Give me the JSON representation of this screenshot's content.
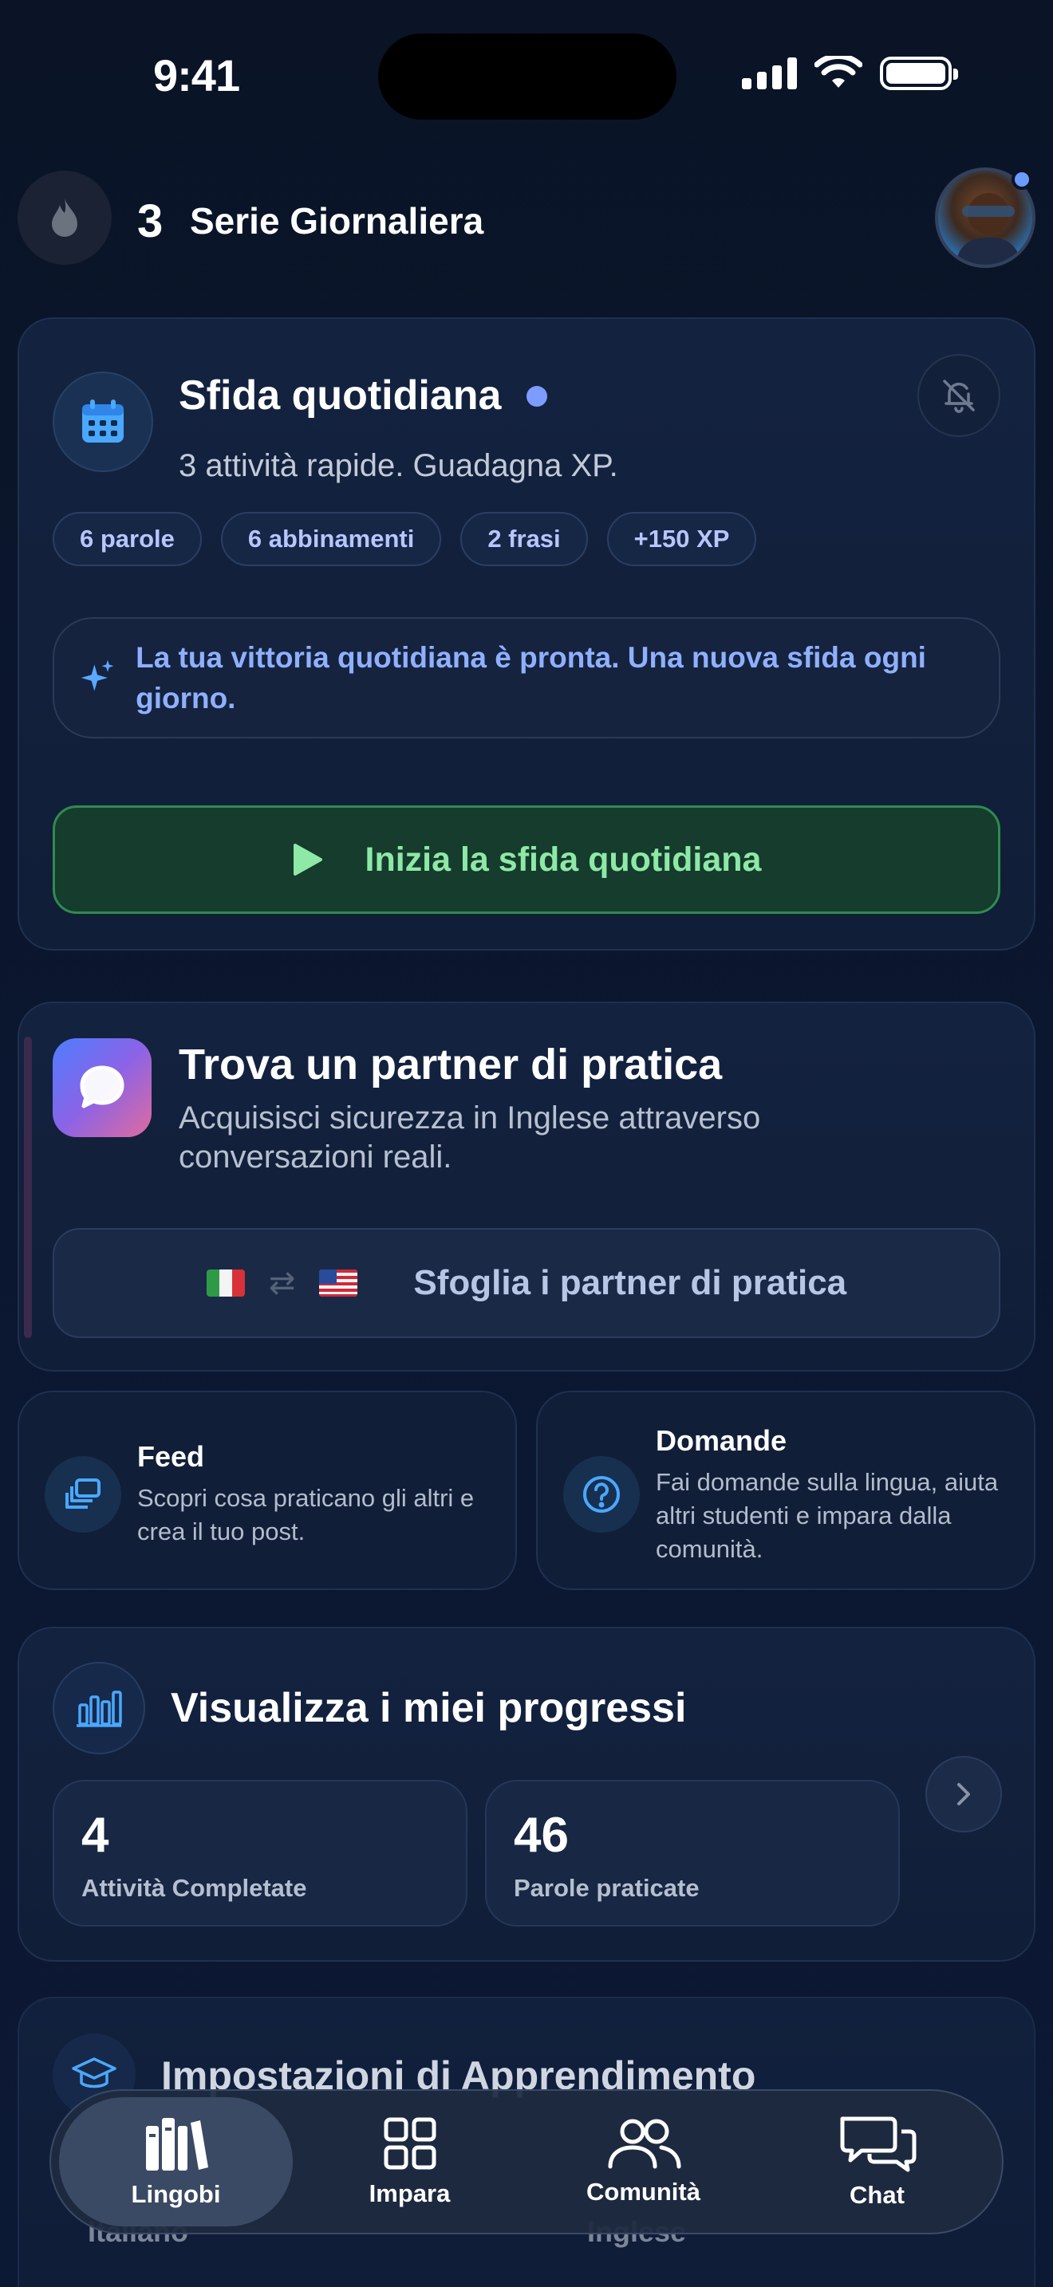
{
  "status_bar": {
    "time": "9:41"
  },
  "header": {
    "streak_count": "3",
    "streak_label": "Serie Giornaliera"
  },
  "challenge": {
    "title": "Sfida quotidiana",
    "subtitle": "3 attività rapide. Guadagna XP.",
    "chips": [
      "6 parole",
      "6 abbinamenti",
      "2 frasi",
      "+150 XP"
    ],
    "info": "La tua vittoria quotidiana è pronta. Una nuova sfida ogni giorno.",
    "start_label": "Inizia la sfida quotidiana"
  },
  "partner": {
    "title": "Trova un partner di pratica",
    "subtitle": "Acquisisci sicurezza in Inglese attraverso conversazioni reali.",
    "browse_label": "Sfoglia i partner di pratica",
    "swap_symbol": "⇄"
  },
  "feed": {
    "title": "Feed",
    "text": "Scopri cosa praticano gli altri e crea il tuo post."
  },
  "questions": {
    "title": "Domande",
    "text": "Fai domande sulla lingua, aiuta altri studenti e impara dalla comunità."
  },
  "progress": {
    "title": "Visualizza i miei progressi",
    "stats": [
      {
        "value": "4",
        "label": "Attività Completate"
      },
      {
        "value": "46",
        "label": "Parole praticate"
      }
    ]
  },
  "settings": {
    "title": "Impostazioni di Apprendimento",
    "from_lang": "Italiano",
    "to_lang": "Inglese"
  },
  "tabs": [
    {
      "label": "Lingobi",
      "active": true
    },
    {
      "label": "Impara",
      "active": false
    },
    {
      "label": "Comunità",
      "active": false
    },
    {
      "label": "Chat",
      "active": false
    }
  ],
  "colors": {
    "accent_green": "#8ee8a6",
    "accent_blue": "#8fb0ff",
    "background": "#0a1426"
  }
}
